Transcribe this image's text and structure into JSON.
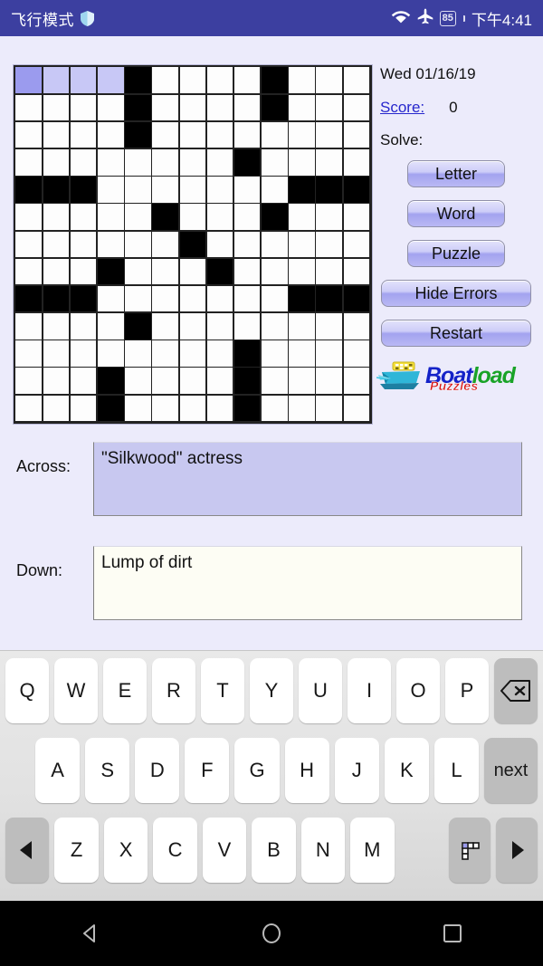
{
  "status_bar": {
    "mode_label": "飞行模式",
    "shield_icon": "shield-icon",
    "wifi_icon": "wifi-icon",
    "airplane_icon": "airplane-icon",
    "battery_level": "85",
    "time": "下午4:41",
    "bg_color": "#3c3fa0"
  },
  "puzzle": {
    "rows": 13,
    "cols": 13,
    "cursor": [
      0,
      0
    ],
    "highlight_cells": [
      [
        0,
        0
      ],
      [
        0,
        1
      ],
      [
        0,
        2
      ],
      [
        0,
        3
      ]
    ],
    "block_cells": [
      [
        0,
        4
      ],
      [
        0,
        9
      ],
      [
        1,
        4
      ],
      [
        1,
        9
      ],
      [
        2,
        4
      ],
      [
        3,
        8
      ],
      [
        4,
        0
      ],
      [
        4,
        1
      ],
      [
        4,
        2
      ],
      [
        4,
        10
      ],
      [
        4,
        11
      ],
      [
        4,
        12
      ],
      [
        5,
        5
      ],
      [
        5,
        9
      ],
      [
        6,
        6
      ],
      [
        7,
        3
      ],
      [
        7,
        7
      ],
      [
        8,
        0
      ],
      [
        8,
        1
      ],
      [
        8,
        2
      ],
      [
        8,
        10
      ],
      [
        8,
        11
      ],
      [
        8,
        12
      ],
      [
        9,
        4
      ],
      [
        10,
        8
      ],
      [
        11,
        3
      ],
      [
        11,
        8
      ],
      [
        12,
        3
      ],
      [
        12,
        8
      ]
    ],
    "cell_color": "#fdfdfd",
    "block_color": "#000000",
    "cursor_color": "#9b9bee",
    "highlight_color": "#c8c8f6"
  },
  "panel": {
    "date": "Wed 01/16/19",
    "score_label": "Score:",
    "score_value": "0",
    "solve_label": "Solve:",
    "buttons": [
      {
        "label": "Letter",
        "size": "small"
      },
      {
        "label": "Word",
        "size": "small"
      },
      {
        "label": "Puzzle",
        "size": "small"
      },
      {
        "label": "Hide Errors",
        "size": "wide"
      },
      {
        "label": "Restart",
        "size": "wide"
      }
    ],
    "logo": {
      "part1": "Boat",
      "part2": "load",
      "sub": "Puzzles",
      "icon": "boat-icon",
      "color1": "#1422c8",
      "color2": "#19a327",
      "color_sub": "#d71414"
    }
  },
  "clues": {
    "across_label": "Across:",
    "across_text": "\"Silkwood\" actress",
    "down_label": "Down:",
    "down_text": "Lump of dirt"
  },
  "keyboard": {
    "row1": [
      "Q",
      "W",
      "E",
      "R",
      "T",
      "Y",
      "U",
      "I",
      "O",
      "P"
    ],
    "row1_fn": "backspace-icon",
    "row2": [
      "A",
      "S",
      "D",
      "F",
      "G",
      "H",
      "J",
      "K",
      "L"
    ],
    "row2_fn": "next",
    "row3": [
      "Z",
      "X",
      "C",
      "V",
      "B",
      "N",
      "M"
    ],
    "row3_left_fn": "arrow-left-icon",
    "row3_grid_fn": "keyboard-switch-icon",
    "row3_right_fn": "arrow-right-icon"
  },
  "nav_bar": {
    "back": "back-icon",
    "home": "home-icon",
    "recents": "recents-icon"
  }
}
